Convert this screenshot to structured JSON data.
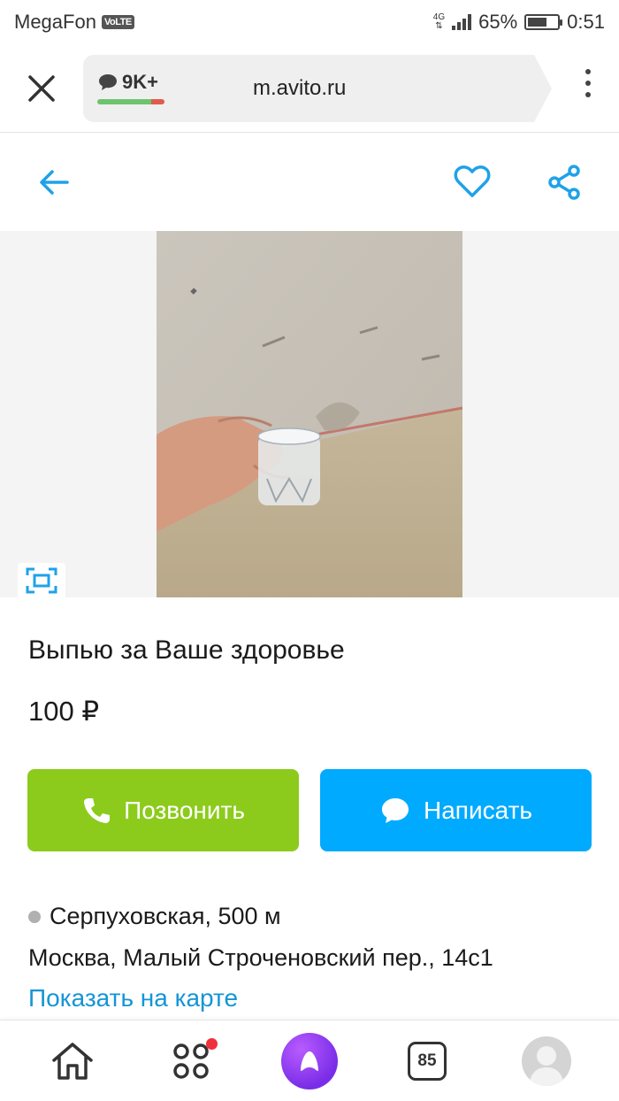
{
  "status_bar": {
    "carrier": "MegaFon",
    "volte": "VoLTE",
    "network": "4G",
    "battery": "65%",
    "battery_level": 0.65,
    "time": "0:51"
  },
  "browser": {
    "comments_count": "9K+",
    "url": "m.avito.ru"
  },
  "listing": {
    "title": "Выпью за Ваше здоровье",
    "price": "100 ₽",
    "call_label": "Позвонить",
    "write_label": "Написать",
    "metro": "Серпуховская, 500 м",
    "address": "Москва, Малый Строченовский пер., 14с1",
    "map_link": "Показать на карте"
  },
  "bottom_nav": {
    "tabs_count": "85"
  },
  "colors": {
    "accent_blue": "#00aaff",
    "call_green": "#8ccb1c",
    "link_blue": "#1495d6"
  },
  "icons": [
    "close-icon",
    "comment-icon",
    "menu-icon",
    "back-arrow-icon",
    "heart-icon",
    "share-icon",
    "expand-icon",
    "phone-icon",
    "chat-icon",
    "home-icon",
    "services-icon",
    "alice-icon",
    "tabs-icon",
    "profile-icon"
  ]
}
